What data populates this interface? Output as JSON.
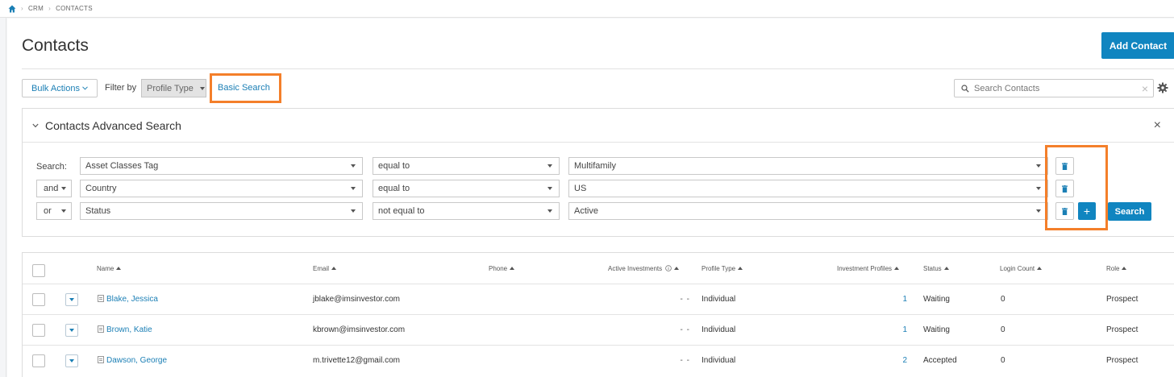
{
  "breadcrumb": {
    "items": [
      "CRM",
      "CONTACTS"
    ]
  },
  "header": {
    "title": "Contacts",
    "add_label": "Add Contact"
  },
  "toolbar": {
    "bulk_label": "Bulk Actions",
    "filter_label": "Filter by",
    "profile_type": "Profile Type",
    "basic_search": "Basic Search",
    "search_placeholder": "Search Contacts"
  },
  "advanced": {
    "title": "Contacts Advanced Search",
    "search_label": "Search:",
    "rows": [
      {
        "connector": "",
        "field": "Asset Classes Tag",
        "operator": "equal to",
        "value": "Multifamily"
      },
      {
        "connector": "and",
        "field": "Country",
        "operator": "equal to",
        "value": "US"
      },
      {
        "connector": "or",
        "field": "Status",
        "operator": "not equal to",
        "value": "Active"
      }
    ],
    "search_button": "Search",
    "add_symbol": "+"
  },
  "table": {
    "columns": [
      "Name",
      "Email",
      "Phone",
      "Active Investments",
      "Profile Type",
      "Investment Profiles",
      "Status",
      "Login Count",
      "Role"
    ],
    "rows": [
      {
        "name": "Blake, Jessica",
        "email": "jblake@imsinvestor.com",
        "phone": "",
        "active": "- -",
        "profile": "Individual",
        "inv_profiles": "1",
        "status": "Waiting",
        "login": "0",
        "role": "Prospect"
      },
      {
        "name": "Brown, Katie",
        "email": "kbrown@imsinvestor.com",
        "phone": "",
        "active": "- -",
        "profile": "Individual",
        "inv_profiles": "1",
        "status": "Waiting",
        "login": "0",
        "role": "Prospect"
      },
      {
        "name": "Dawson, George",
        "email": "m.trivette12@gmail.com",
        "phone": "",
        "active": "- -",
        "profile": "Individual",
        "inv_profiles": "2",
        "status": "Accepted",
        "login": "0",
        "role": "Prospect"
      }
    ]
  },
  "colors": {
    "accent": "#1085c0",
    "link": "#1b7fb5",
    "highlight": "#f47f2a"
  }
}
